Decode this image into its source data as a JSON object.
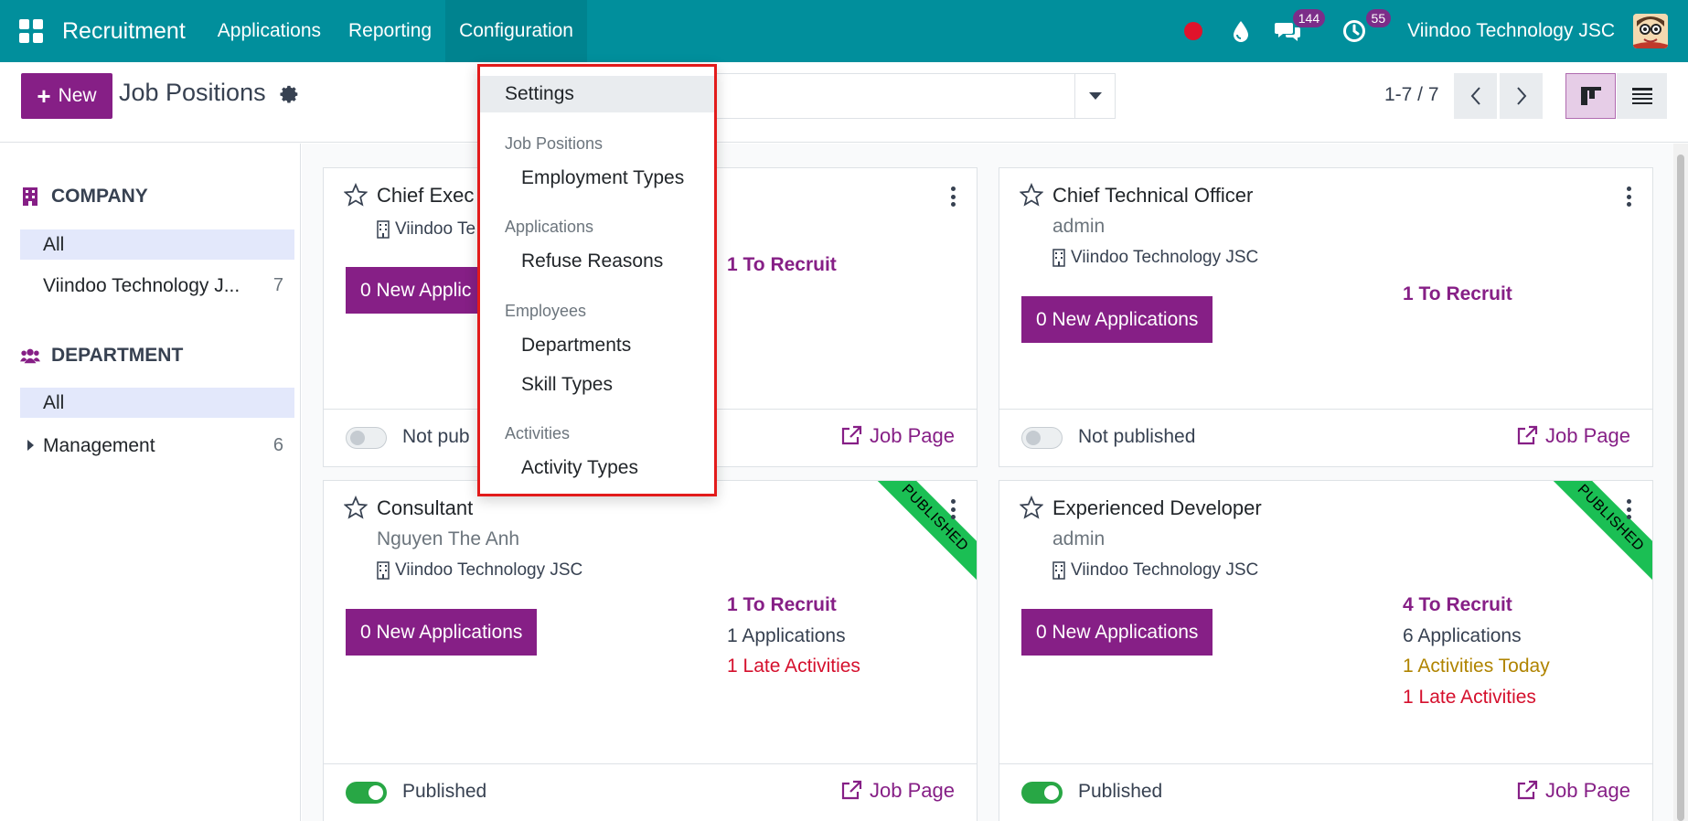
{
  "navbar": {
    "app_name": "Recruitment",
    "menus": [
      {
        "label": "Applications"
      },
      {
        "label": "Reporting"
      },
      {
        "label": "Configuration"
      }
    ],
    "messages_badge": "144",
    "activities_badge": "55",
    "company": "Viindoo Technology JSC",
    "color": "#018f9c"
  },
  "control": {
    "new_label": "New",
    "title": "Job Positions",
    "pager": "1-7 / 7",
    "accent": "#861f86"
  },
  "sidebar": {
    "company_header": "COMPANY",
    "company_items": [
      {
        "label": "All",
        "count": ""
      },
      {
        "label": "Viindoo Technology J...",
        "count": "7"
      }
    ],
    "department_header": "DEPARTMENT",
    "department_items": [
      {
        "label": "All",
        "count": ""
      },
      {
        "label": "Management",
        "count": "6"
      }
    ]
  },
  "dropdown": {
    "settings": "Settings",
    "sections": [
      {
        "header": "Job Positions",
        "items": [
          "Employment Types"
        ]
      },
      {
        "header": "Applications",
        "items": [
          "Refuse Reasons"
        ]
      },
      {
        "header": "Employees",
        "items": [
          "Departments",
          "Skill Types"
        ]
      },
      {
        "header": "Activities",
        "items": [
          "Activity Types"
        ]
      }
    ]
  },
  "cards": [
    {
      "title": "Chief Exec",
      "company": "Viindoo Te",
      "new_apps": "0 New Applic",
      "to_recruit": "1 To Recruit",
      "status": "Not pub",
      "job_page": "Job Page"
    },
    {
      "title": "Chief Technical Officer",
      "recruiter": "admin",
      "company": "Viindoo Technology JSC",
      "new_apps": "0 New Applications",
      "to_recruit": "1 To Recruit",
      "status": "Not published",
      "job_page": "Job Page"
    },
    {
      "title": "Consultant",
      "recruiter": "Nguyen The Anh",
      "company": "Viindoo Technology JSC",
      "new_apps": "0 New Applications",
      "to_recruit": "1 To Recruit",
      "applications": "1 Applications",
      "late": "1 Late Activities",
      "status": "Published",
      "job_page": "Job Page",
      "ribbon": "PUBLISHED"
    },
    {
      "title": "Experienced Developer",
      "recruiter": "admin",
      "company": "Viindoo Technology JSC",
      "new_apps": "0 New Applications",
      "to_recruit": "4 To Recruit",
      "applications": "6 Applications",
      "today": "1 Activities Today",
      "late": "1 Late Activities",
      "status": "Published",
      "job_page": "Job Page",
      "ribbon": "PUBLISHED"
    }
  ]
}
